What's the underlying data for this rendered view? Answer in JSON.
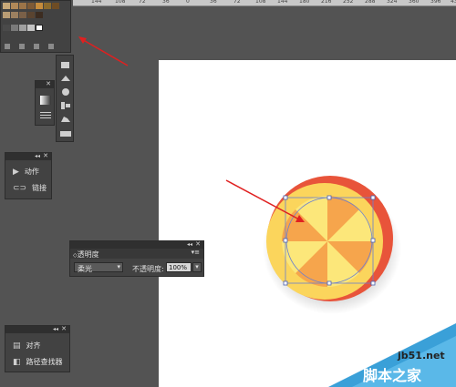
{
  "ruler": {
    "ticks": [
      "144",
      "108",
      "72",
      "36",
      "0",
      "36",
      "72",
      "108",
      "144",
      "180",
      "216",
      "252",
      "288",
      "324",
      "360",
      "396",
      "432"
    ]
  },
  "actions_panel": {
    "items": [
      {
        "label": "动作",
        "icon": "play-icon"
      },
      {
        "label": "链接",
        "icon": "link-icon"
      }
    ]
  },
  "transparency_panel": {
    "title": "透明度",
    "blend_mode": "柔光",
    "opacity_label": "不透明度:",
    "opacity_value": "100%"
  },
  "align_panel": {
    "items": [
      {
        "label": "对齐",
        "icon": "align-icon"
      },
      {
        "label": "路径查找器",
        "icon": "pathfinder-icon"
      }
    ]
  },
  "watermark": {
    "site": "jb51.net",
    "name": "脚本之家"
  },
  "colors": {
    "workspace": "#535353",
    "panel": "#424242",
    "artboard": "#ffffff",
    "accent": "#e8543a",
    "circle_light": "#fce77a",
    "circle_mid": "#f6a54c"
  }
}
